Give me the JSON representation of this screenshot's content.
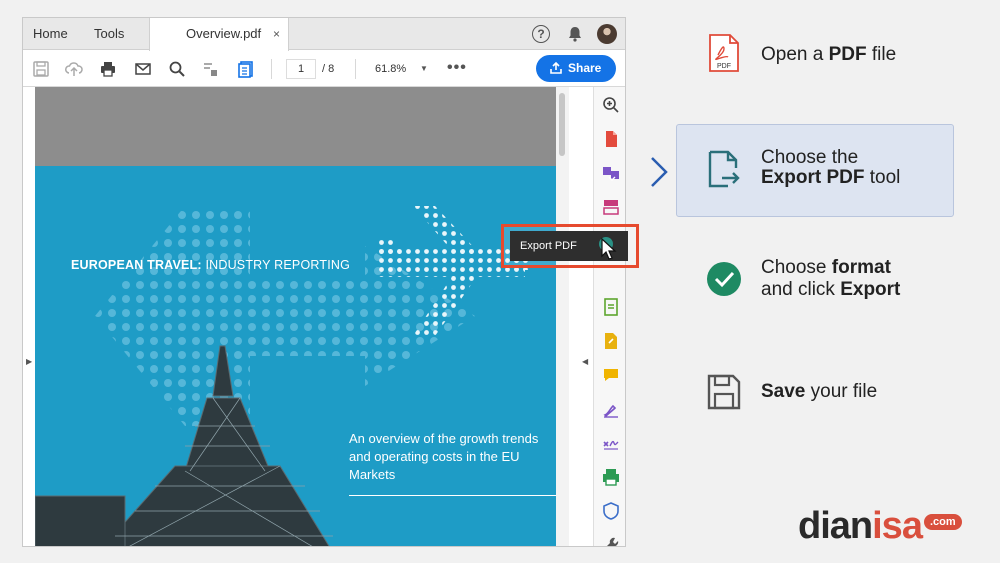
{
  "window": {
    "tabs": {
      "home": "Home",
      "tools": "Tools",
      "document": "Overview.pdf",
      "close": "×"
    },
    "top_icons": {
      "help": "?",
      "bell": "bell-icon",
      "avatar": "avatar"
    },
    "toolbar": {
      "page_current": "1",
      "page_total": "/ 8",
      "zoom": "61.8%",
      "zoom_caret": "▼",
      "more": "•••",
      "share_label": "Share"
    },
    "document": {
      "headline_bold": "EUROPEAN TRAVEL:",
      "headline_rest": " INDUSTRY REPORTING",
      "subtitle": "An overview of the growth trends and operating costs in the EU Markets",
      "page_color": "#1e9cc6"
    },
    "tooltip": {
      "label": "Export PDF",
      "border_color": "#e64a2e"
    },
    "handles": {
      "left": "▶",
      "right": "◀"
    }
  },
  "steps": [
    {
      "icon": "pdf-file-icon",
      "pdf_badge": "PDF",
      "pre": "Open a ",
      "bold": "PDF",
      "post": " file",
      "line2": ""
    },
    {
      "icon": "export-pdf-icon",
      "pre": "Choose the",
      "bold": "Export PDF",
      "post": " tool",
      "active": true
    },
    {
      "icon": "checkmark-circle-icon",
      "pre": "Choose ",
      "bold": "format",
      "line2_pre": "and click ",
      "line2_bold": "Export"
    },
    {
      "icon": "save-disk-icon",
      "bold": "Save",
      "post": " your file"
    }
  ],
  "logo": {
    "part1": "dian",
    "part2": "isa",
    "suffix": ".com"
  },
  "colors": {
    "accent_blue": "#1473e6",
    "active_step_bg": "#dde4f1",
    "teal_icon": "#2a6f7a",
    "green_check": "#1e8a63",
    "logo_red": "#d94f3d"
  }
}
